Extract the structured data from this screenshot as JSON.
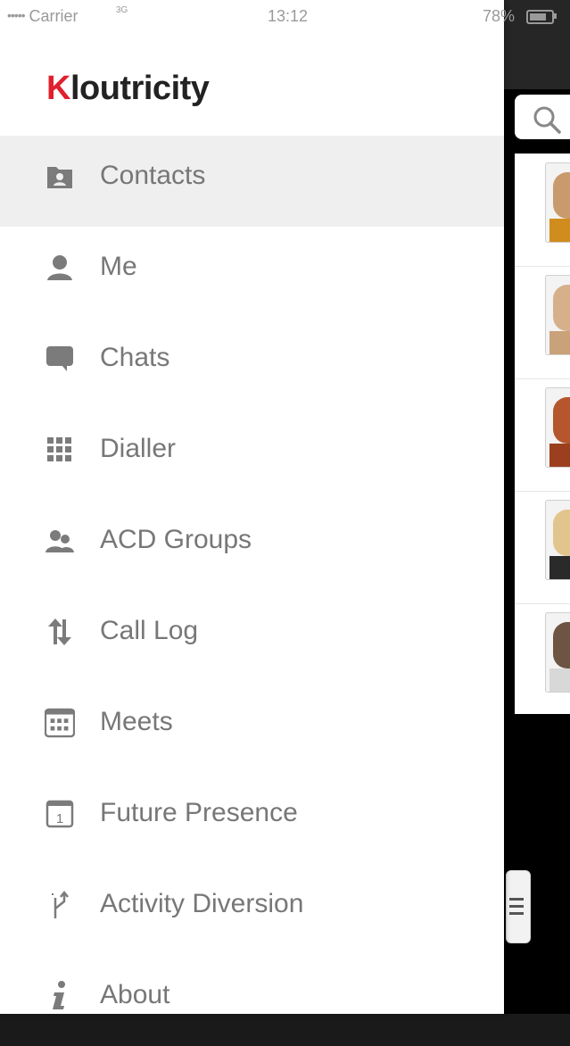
{
  "status_bar": {
    "signal": "•••••",
    "carrier": "Carrier",
    "network": "3G",
    "time": "13:12",
    "battery": "78%"
  },
  "app": {
    "logo_first": "K",
    "logo_rest": "loutricity",
    "brand_color": "#e0202e"
  },
  "menu": {
    "items": [
      {
        "label": "Contacts",
        "icon": "contacts-icon",
        "active": true
      },
      {
        "label": "Me",
        "icon": "person-icon"
      },
      {
        "label": "Chats",
        "icon": "chat-bubble-icon"
      },
      {
        "label": "Dialler",
        "icon": "keypad-icon"
      },
      {
        "label": "ACD Groups",
        "icon": "group-icon"
      },
      {
        "label": "Call Log",
        "icon": "up-down-arrows-icon"
      },
      {
        "label": "Meets",
        "icon": "calendar-grid-icon"
      },
      {
        "label": "Future Presence",
        "icon": "calendar-day-icon"
      },
      {
        "label": "Activity Diversion",
        "icon": "diversion-arrow-icon"
      },
      {
        "label": "About",
        "icon": "info-icon"
      }
    ]
  },
  "colors": {
    "menu_text": "#777777",
    "active_row": "#efefef"
  }
}
